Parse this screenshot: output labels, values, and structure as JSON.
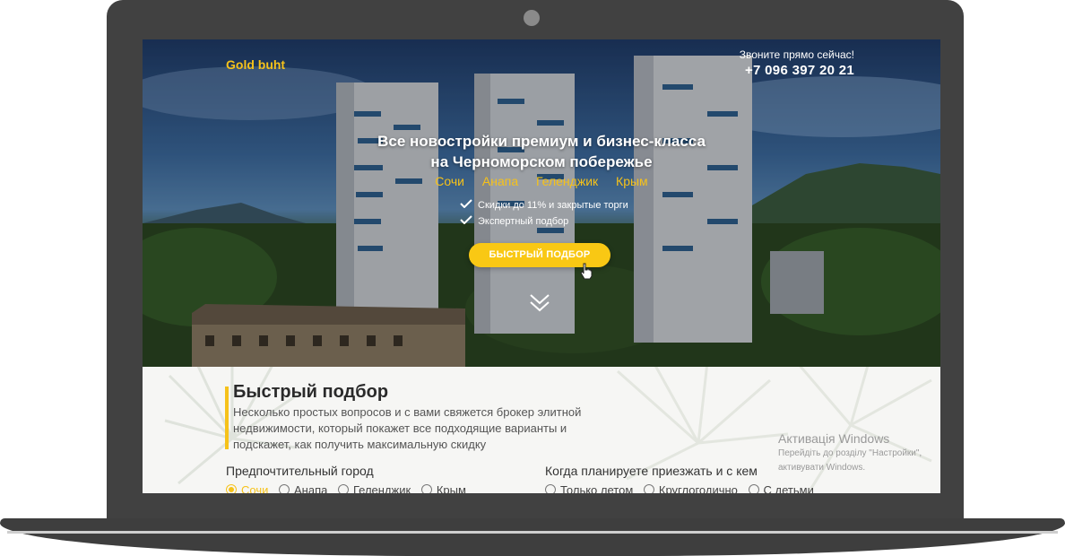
{
  "header": {
    "logo": "Gold buht",
    "call_label": "Звоните прямо сейчас!",
    "phone": "+7 096 397 20 21"
  },
  "hero": {
    "headline_1": "Все новостройки премиум и бизнес-класса",
    "headline_2": "на Черноморском побережье",
    "cities": [
      "Сочи",
      "Анапа",
      "Геленджик",
      "Крым"
    ],
    "features": [
      "Скидки до 11% и закрытые торги",
      "Экспертный подбор"
    ],
    "cta_label": "БЫСТРЫЙ ПОДБОР"
  },
  "quick": {
    "title": "Быстрый подбор",
    "description": "Несколько простых вопросов и с вами свяжется брокер элитной недвижимости, который покажет все подходящие варианты и подскажет, как получить максимальную скидку",
    "city_group": {
      "title": "Предпочтительный город",
      "options": [
        "Сочи",
        "Анапа",
        "Геленджик",
        "Крым"
      ],
      "selected": "Сочи"
    },
    "arrival_group": {
      "title": "Когда планируете приезжать и с кем",
      "options": [
        "Только летом",
        "Круглогодично",
        "С детьми"
      ]
    }
  },
  "windows_watermark": {
    "title": "Активація Windows",
    "line_1": "Перейдіть до розділу \"Настройки\",",
    "line_2": "активувати Windows."
  },
  "colors": {
    "accent": "#f6c21a",
    "frame": "#414141"
  }
}
